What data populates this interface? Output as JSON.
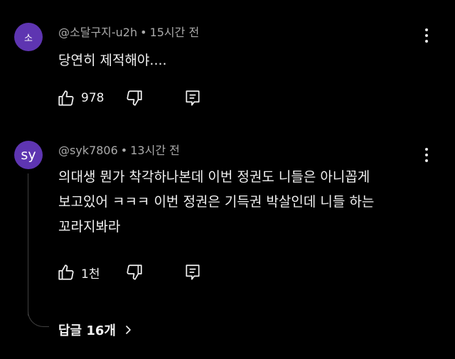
{
  "comments": [
    {
      "avatar_initial": "소",
      "avatar_color": "#5e35b1",
      "author": "@소달구지-u2h",
      "separator": "•",
      "time": "15시간 전",
      "text": "당연히 제적해야....",
      "likes": "978",
      "icons": {
        "like": "thumbs-up-icon",
        "dislike": "thumbs-down-icon",
        "reply": "reply-icon",
        "more": "more-vert-icon"
      }
    },
    {
      "avatar_initial": "sy",
      "avatar_color": "#5e35b1",
      "author": "@syk7806",
      "separator": "•",
      "time": "13시간 전",
      "text": "의대생 뭔가 착각하나본데 이번 정권도 니들은 아니꼽게\n보고있어 ㅋㅋㅋ 이번 정권은 기득권 박살인데 니들 하는\n꼬라지봐라",
      "likes": "1천",
      "icons": {
        "like": "thumbs-up-icon",
        "dislike": "thumbs-down-icon",
        "reply": "reply-icon",
        "more": "more-vert-icon"
      }
    }
  ],
  "replies_label": "답글 16개",
  "replies_icon": "chevron-right-icon"
}
